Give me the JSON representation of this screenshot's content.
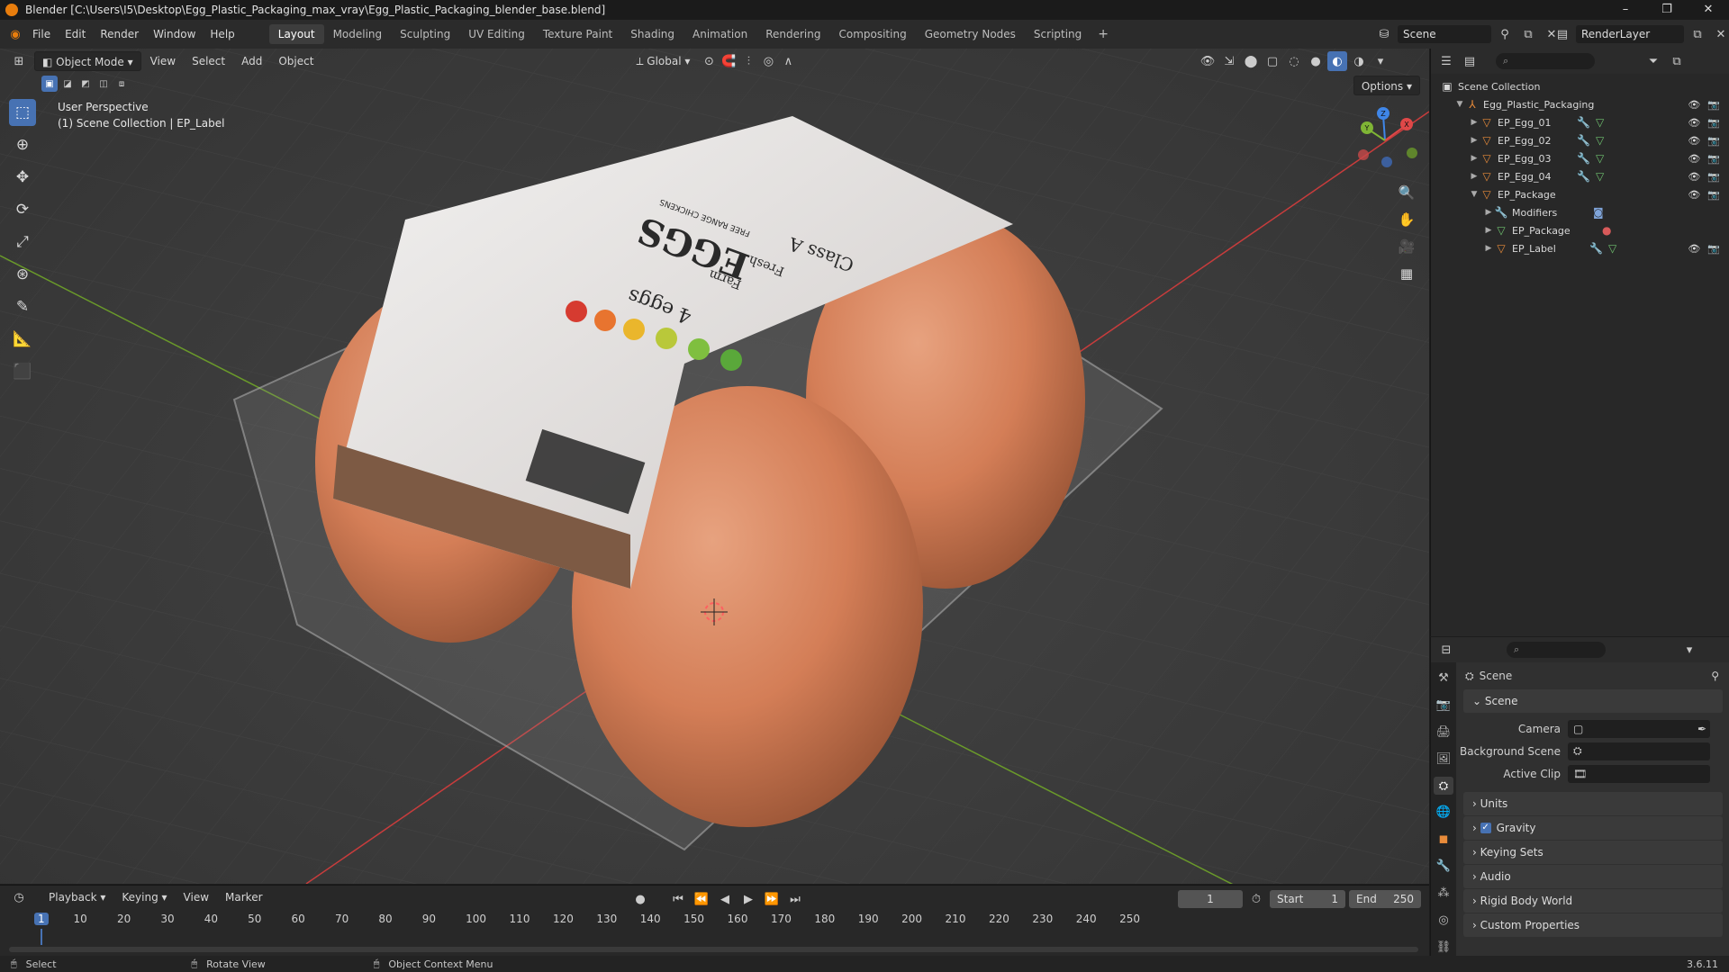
{
  "window": {
    "title": "Blender [C:\\Users\\I5\\Desktop\\Egg_Plastic_Packaging_max_vray\\Egg_Plastic_Packaging_blender_base.blend]",
    "controls": [
      "–",
      "❐",
      "✕"
    ]
  },
  "menu": [
    "File",
    "Edit",
    "Render",
    "Window",
    "Help"
  ],
  "workspaces": [
    "Layout",
    "Modeling",
    "Sculpting",
    "UV Editing",
    "Texture Paint",
    "Shading",
    "Animation",
    "Rendering",
    "Compositing",
    "Geometry Nodes",
    "Scripting"
  ],
  "active_workspace": "Layout",
  "scene_name": "Scene",
  "view_layer": "RenderLayer",
  "viewport": {
    "mode": "Object Mode",
    "menus": [
      "View",
      "Select",
      "Add",
      "Object"
    ],
    "transform": "Global",
    "options_label": "Options",
    "info_line1": "User Perspective",
    "info_line2": "(1) Scene Collection | EP_Label",
    "gizmo_labels": {
      "x": "X",
      "y": "Y",
      "z": "Z"
    }
  },
  "label_texts": {
    "count": "4 eggs",
    "farm": "Farm",
    "fresh": "Fresh",
    "brand": "EGGS",
    "tag": "FREE RANGE CHICKENS",
    "class": "Class A"
  },
  "outliner": {
    "root": "Scene Collection",
    "collection": "Egg_Plastic_Packaging",
    "items": [
      {
        "name": "EP_Egg_01",
        "depth": 2
      },
      {
        "name": "EP_Egg_02",
        "depth": 2
      },
      {
        "name": "EP_Egg_03",
        "depth": 2
      },
      {
        "name": "EP_Egg_04",
        "depth": 2
      },
      {
        "name": "EP_Package",
        "depth": 2
      },
      {
        "name": "Modifiers",
        "depth": 3
      },
      {
        "name": "EP_Package",
        "depth": 3
      },
      {
        "name": "EP_Label",
        "depth": 3
      }
    ]
  },
  "properties": {
    "header": "Scene",
    "section_scene": "Scene",
    "fields": [
      {
        "label": "Camera"
      },
      {
        "label": "Background Scene"
      },
      {
        "label": "Active Clip"
      }
    ],
    "sections": [
      "Units",
      "Gravity",
      "Keying Sets",
      "Audio",
      "Rigid Body World",
      "Custom Properties"
    ],
    "gravity_checked": true
  },
  "timeline": {
    "menus": [
      "Playback",
      "Keying",
      "View",
      "Marker"
    ],
    "current_frame": "1",
    "start_label": "Start",
    "start": "1",
    "end_label": "End",
    "end": "250",
    "ticks": [
      "1",
      "10",
      "20",
      "30",
      "40",
      "50",
      "60",
      "70",
      "80",
      "90",
      "100",
      "110",
      "120",
      "130",
      "140",
      "150",
      "160",
      "170",
      "180",
      "190",
      "200",
      "210",
      "220",
      "230",
      "240",
      "250"
    ]
  },
  "status": {
    "select": "Select",
    "rotate": "Rotate View",
    "context": "Object Context Menu",
    "version": "3.6.11"
  },
  "colors": {
    "accent": "#4772b3",
    "egg": "#d9825a",
    "x_axis": "#c83c3c",
    "y_axis": "#6a9a2a",
    "gizmo_x": "#e04848",
    "gizmo_y": "#7fb535",
    "gizmo_z": "#3f86e8"
  }
}
